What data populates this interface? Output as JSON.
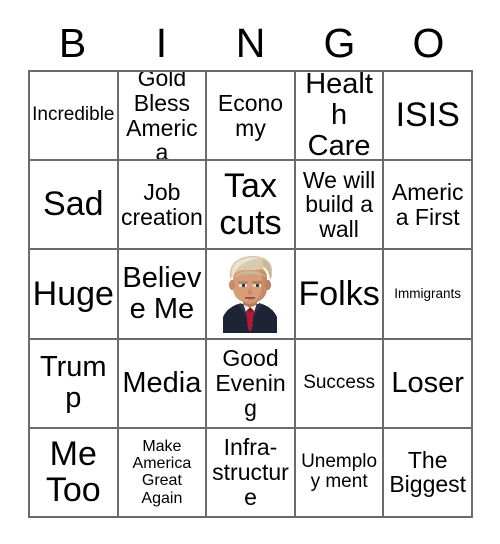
{
  "card": {
    "header_letters": [
      "B",
      "I",
      "N",
      "G",
      "O"
    ],
    "border_color": "#6b6b6b",
    "background_color": "#ffffff",
    "text_color": "#000000",
    "rows": [
      [
        {
          "label": "Incredible",
          "size": "s-sm"
        },
        {
          "label": "Gold Bless America",
          "size": "s-md"
        },
        {
          "label": "Economy",
          "size": "s-md"
        },
        {
          "label": "Health Care",
          "size": "s-lg"
        },
        {
          "label": "ISIS",
          "size": "s-xl"
        }
      ],
      [
        {
          "label": "Sad",
          "size": "s-xl"
        },
        {
          "label": "Job creation",
          "size": "s-md"
        },
        {
          "label": "Tax cuts",
          "size": "s-xl"
        },
        {
          "label": "We will build a wall",
          "size": "s-md"
        },
        {
          "label": "America First",
          "size": "s-md"
        }
      ],
      [
        {
          "label": "Huge",
          "size": "s-xl"
        },
        {
          "label": "Believe Me",
          "size": "s-lg"
        },
        {
          "label": "",
          "size": "free",
          "free_space": true,
          "image": "trump-portrait"
        },
        {
          "label": "Folks",
          "size": "s-xl"
        },
        {
          "label": "Immigrants",
          "size": "s-xxs"
        }
      ],
      [
        {
          "label": "Trump",
          "size": "s-lg"
        },
        {
          "label": "Media",
          "size": "s-lg"
        },
        {
          "label": "Good Evening",
          "size": "s-md"
        },
        {
          "label": "Success",
          "size": "s-sm"
        },
        {
          "label": "Loser",
          "size": "s-lg"
        }
      ],
      [
        {
          "label": "Me Too",
          "size": "s-xl"
        },
        {
          "label": "Make America Great Again",
          "size": "s-xs"
        },
        {
          "label": "Infra- structure",
          "size": "s-md"
        },
        {
          "label": "Unemploy ment",
          "size": "s-sm"
        },
        {
          "label": "The Biggest",
          "size": "s-md"
        }
      ]
    ],
    "free_space": {
      "name": "trump-portrait",
      "colors": {
        "hair": "#d9cbb0",
        "hair_light": "#ece3d0",
        "skin": "#d79c78",
        "skin_shadow": "#b8795a",
        "suit": "#1c2436",
        "shirt": "#f2f0ee",
        "tie": "#b21934"
      }
    }
  }
}
